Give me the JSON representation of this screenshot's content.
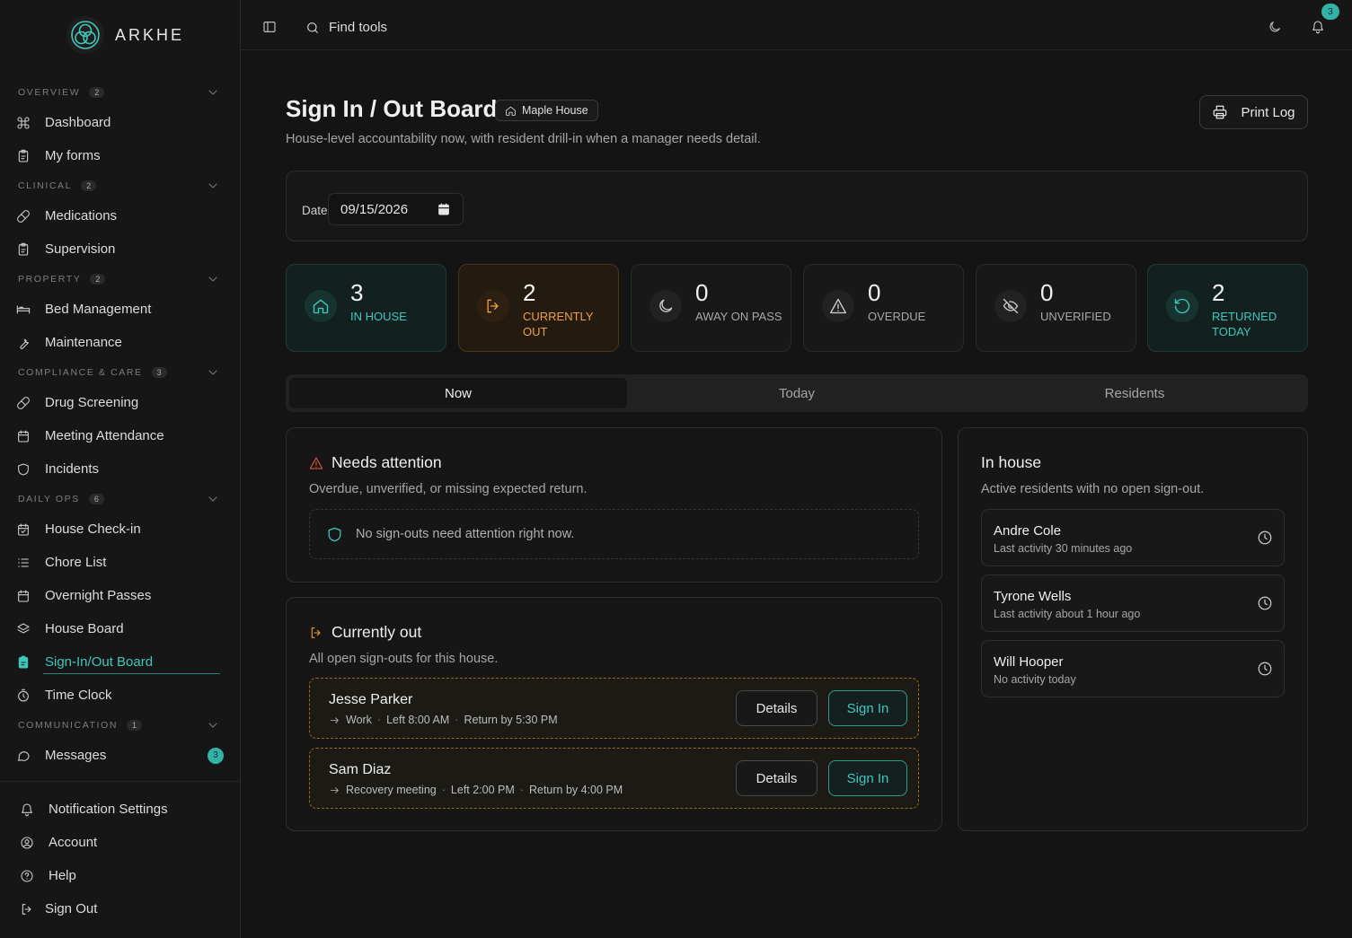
{
  "app": {
    "brand": "ARKHE"
  },
  "sidebar": {
    "sections": [
      {
        "title": "OVERVIEW",
        "count": "2",
        "items": [
          {
            "label": "Dashboard",
            "icon": "command-icon"
          },
          {
            "label": "My forms",
            "icon": "clipboard-icon"
          }
        ]
      },
      {
        "title": "CLINICAL",
        "count": "2",
        "items": [
          {
            "label": "Medications",
            "icon": "pill-icon"
          },
          {
            "label": "Supervision",
            "icon": "clipboard-icon"
          }
        ]
      },
      {
        "title": "PROPERTY",
        "count": "2",
        "items": [
          {
            "label": "Bed Management",
            "icon": "bed-icon"
          },
          {
            "label": "Maintenance",
            "icon": "wrench-icon"
          }
        ]
      },
      {
        "title": "COMPLIANCE & CARE",
        "count": "3",
        "items": [
          {
            "label": "Drug Screening",
            "icon": "pill-icon"
          },
          {
            "label": "Meeting Attendance",
            "icon": "calendar-icon"
          },
          {
            "label": "Incidents",
            "icon": "shield-icon"
          }
        ]
      },
      {
        "title": "DAILY OPS",
        "count": "6",
        "items": [
          {
            "label": "House Check-in",
            "icon": "calendar-check-icon"
          },
          {
            "label": "Chore List",
            "icon": "list-icon"
          },
          {
            "label": "Overnight Passes",
            "icon": "calendar-icon"
          },
          {
            "label": "House Board",
            "icon": "layers-icon"
          },
          {
            "label": "Sign-In/Out Board",
            "icon": "clipboard-filled-icon"
          },
          {
            "label": "Time Clock",
            "icon": "timer-icon"
          }
        ]
      },
      {
        "title": "COMMUNICATION",
        "count": "1",
        "items": [
          {
            "label": "Messages",
            "icon": "message-icon",
            "badge": "3"
          }
        ]
      }
    ],
    "active_item": "Sign-In/Out Board",
    "bottom": [
      {
        "label": "Notification Settings",
        "icon": "bell-icon"
      },
      {
        "label": "Account",
        "icon": "user-circle-icon"
      },
      {
        "label": "Help",
        "icon": "help-icon"
      },
      {
        "label": "Sign Out",
        "icon": "sign-out-icon"
      }
    ]
  },
  "topbar": {
    "search_label": "Find tools",
    "notification_count": "3"
  },
  "header": {
    "title": "Sign In / Out Board",
    "house": "Maple House",
    "subtitle": "House-level accountability now, with resident drill-in when a manager needs detail.",
    "print_label": "Print Log"
  },
  "date_filter": {
    "label": "Date",
    "value": "09/15/2026"
  },
  "stats": [
    {
      "value": "3",
      "label": "IN HOUSE",
      "icon": "home-icon",
      "tone": "teal"
    },
    {
      "value": "2",
      "label": "CURRENTLY OUT",
      "icon": "log-out-icon",
      "tone": "orange"
    },
    {
      "value": "0",
      "label": "AWAY ON PASS",
      "icon": "moon-icon",
      "tone": "gray"
    },
    {
      "value": "0",
      "label": "OVERDUE",
      "icon": "alert-triangle-icon",
      "tone": "gray"
    },
    {
      "value": "0",
      "label": "UNVERIFIED",
      "icon": "eye-off-icon",
      "tone": "gray"
    },
    {
      "value": "2",
      "label": "RETURNED TODAY",
      "icon": "rotate-ccw-icon",
      "tone": "teal"
    }
  ],
  "tabs": [
    {
      "label": "Now"
    },
    {
      "label": "Today"
    },
    {
      "label": "Residents"
    }
  ],
  "active_tab": "Now",
  "needs_attention": {
    "title": "Needs attention",
    "subtitle": "Overdue, unverified, or missing expected return.",
    "empty": "No sign-outs need attention right now."
  },
  "currently_out": {
    "title": "Currently out",
    "subtitle": "All open sign-outs for this house.",
    "rows": [
      {
        "name": "Jesse Parker",
        "destination": "Work",
        "left": "Left 8:00 AM",
        "return_by": "Return by 5:30 PM",
        "details_label": "Details",
        "signin_label": "Sign In"
      },
      {
        "name": "Sam Diaz",
        "destination": "Recovery meeting",
        "left": "Left 2:00 PM",
        "return_by": "Return by 4:00 PM",
        "details_label": "Details",
        "signin_label": "Sign In"
      }
    ]
  },
  "in_house": {
    "title": "In house",
    "subtitle": "Active residents with no open sign-out.",
    "residents": [
      {
        "name": "Andre Cole",
        "activity": "Last activity 30 minutes ago"
      },
      {
        "name": "Tyrone Wells",
        "activity": "Last activity about 1 hour ago"
      },
      {
        "name": "Will Hooper",
        "activity": "No activity today"
      }
    ]
  },
  "colors": {
    "accent": "#3fc7bb",
    "warning": "#f0a040",
    "danger": "#e8584c",
    "background": "#141414"
  }
}
